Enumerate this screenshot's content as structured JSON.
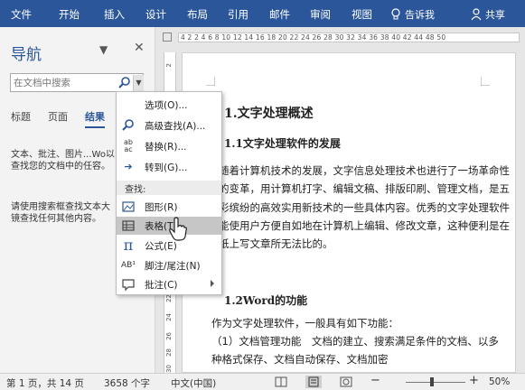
{
  "ribbon": {
    "tabs": [
      "文件",
      "开始",
      "插入",
      "设计",
      "布局",
      "引用",
      "邮件",
      "审阅",
      "视图"
    ],
    "tell_me": "告诉我",
    "share": "共享"
  },
  "nav": {
    "title": "导航",
    "search_placeholder": "在文档中搜索",
    "tabs": [
      "标题",
      "页面",
      "结果"
    ],
    "active_tab": "结果",
    "result_text": "文本、批注、图片...Wo以查找您的文档中的任容。",
    "hint_text": "请使用搜索框查找文本大镜查找任何其他内容。"
  },
  "ruler": {
    "numbers": "4  2     2  4  6  8 10 12 14 16 18 20 22 24 26 28 30 32 34 36 38 40 42 44     48 50",
    "vertical": [
      "2",
      "20",
      "22",
      "24",
      "26",
      "28",
      "30"
    ]
  },
  "document": {
    "heading1": "1.文字处理概述",
    "heading2a": "1.1文字处理软件的发展",
    "para1": "随着计算机技术的发展，文字信息处理技术也进行了一场革命性的变革，用计算机打字、编辑文稿、排版印刷、管理文档，是五彩缤纷的高效实用新技术的一些具体内容。优秀的文字处理软件能使用户方便自如地在计算机上编辑、修改文章，这种便利是在纸上写文章所无法比的。",
    "heading2b": "1.2Word的功能",
    "para2": "作为文字处理软件，一般具有如下功能：",
    "para3": "（1）文档管理功能　文档的建立、搜索满足条件的文档、以多种格式保存、文档自动保存、文档加密"
  },
  "menu": {
    "items": [
      {
        "label": "选项(O)...",
        "icon": "none"
      },
      {
        "label": "高级查找(A)...",
        "icon": "magnifier-icon"
      },
      {
        "label": "替换(R)...",
        "icon": "replace-icon"
      },
      {
        "label": "转到(G)...",
        "icon": "arrow-right-icon"
      }
    ],
    "section": "查找:",
    "find_items": [
      {
        "label": "图形(R)",
        "icon": "graphic-icon"
      },
      {
        "label": "表格(T)",
        "icon": "table-icon"
      },
      {
        "label": "公式(E)",
        "icon": "pi-icon"
      },
      {
        "label": "脚注/尾注(N)",
        "icon": "footnote-icon"
      },
      {
        "label": "批注(C)",
        "icon": "comment-icon"
      }
    ],
    "highlighted": "表格(T)"
  },
  "status": {
    "page": "第 1 页，共 14 页",
    "words": "3658 个字",
    "language": "中文(中国)",
    "zoom": "50%",
    "minus": "−",
    "plus": "+"
  },
  "colors": {
    "accent": "#2b579a",
    "highlight": "#c6c6c6"
  }
}
